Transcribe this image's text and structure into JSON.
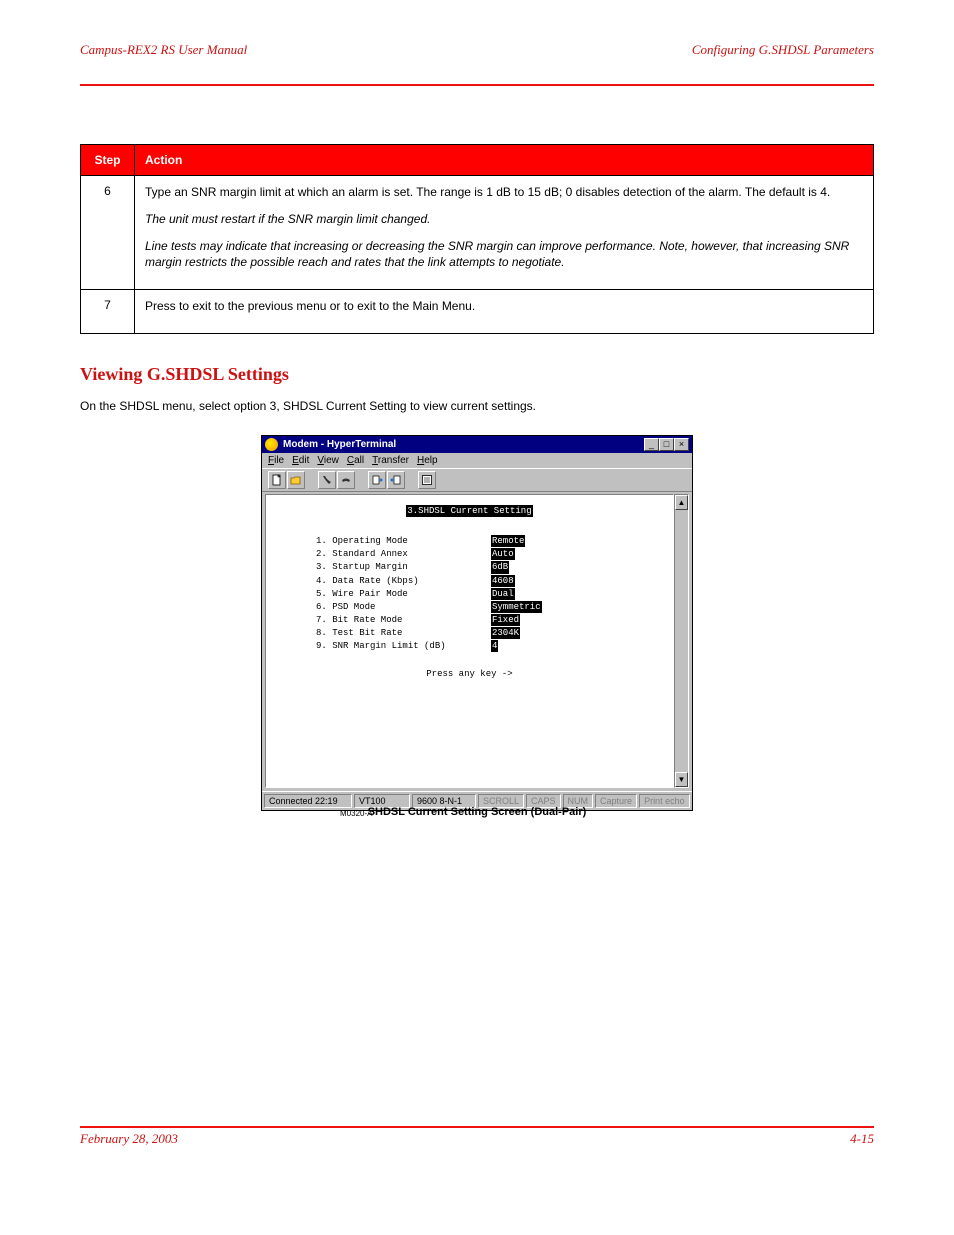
{
  "header": {
    "left": "Campus-REX2 RS User Manual",
    "right": "Configuring G.SHDSL Parameters"
  },
  "table": {
    "head_step": "Step",
    "head_action": "Action",
    "rows": [
      {
        "step": "6",
        "paras": [
          "Type an SNR margin limit at which an alarm is set. The range is 1 dB to 15 dB; 0 disables detection of the alarm. The default is 4.",
          "The unit must restart if the SNR margin limit changed.",
          "Line tests may indicate that increasing or decreasing the SNR margin can improve performance. Note, however, that increasing SNR margin restricts the possible reach and rates that the link attempts to negotiate."
        ]
      },
      {
        "step": "7",
        "paras": [
          "Press     to exit to the previous menu or     to exit to the Main Menu."
        ]
      }
    ]
  },
  "section": {
    "title": "Viewing G.SHDSL Settings",
    "body": "On the SHDSL menu, select option 3, SHDSL Current Setting to view current settings."
  },
  "figure": {
    "id": "M0320-A",
    "caption": "SHDSL Current Setting Screen (Dual-Pair)"
  },
  "hyperterminal": {
    "title": "Modem - HyperTerminal",
    "menu": [
      "File",
      "Edit",
      "View",
      "Call",
      "Transfer",
      "Help"
    ],
    "screen_title": "3.SHDSL Current Setting",
    "items": [
      {
        "n": "1",
        "label": "Operating Mode",
        "value": "Remote"
      },
      {
        "n": "2",
        "label": "Standard Annex",
        "value": "Auto"
      },
      {
        "n": "3",
        "label": "Startup Margin",
        "value": "6dB  "
      },
      {
        "n": "4",
        "label": "Data Rate (Kbps)",
        "value": "4608 "
      },
      {
        "n": "5",
        "label": "Wire Pair Mode",
        "value": "Dual "
      },
      {
        "n": "6",
        "label": "PSD Mode",
        "value": "Symmetric"
      },
      {
        "n": "7",
        "label": "Bit Rate Mode",
        "value": "Fixed"
      },
      {
        "n": "8",
        "label": "Test Bit Rate",
        "value": "2304K"
      },
      {
        "n": "9",
        "label": "SNR Margin Limit (dB)",
        "value": "4        "
      }
    ],
    "press": "Press any key ->",
    "status": {
      "time": "22:19",
      "emul": "VT100",
      "conn": "9600 8-N-1",
      "cells": [
        "SCROLL",
        "CAPS",
        "NUM",
        "Capture",
        "Print echo"
      ]
    }
  },
  "footer": {
    "left": "February 28, 2003",
    "right": "4-15"
  }
}
